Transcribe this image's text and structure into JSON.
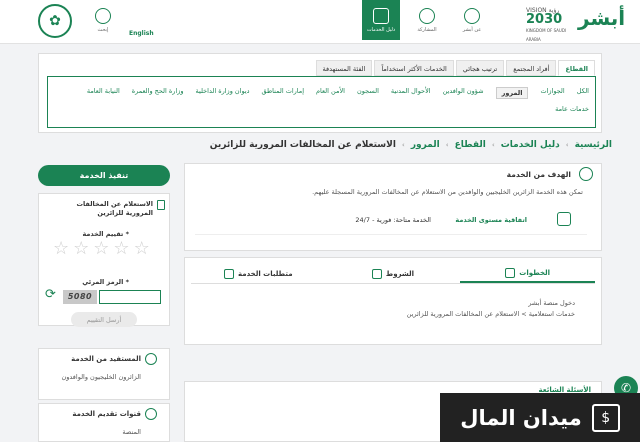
{
  "header": {
    "english_label": "English",
    "nav": [
      {
        "label": "إبحث",
        "icon": "search-icon"
      },
      {
        "label": "دليل الخدمات",
        "icon": "book-icon"
      },
      {
        "label": "المشاركة",
        "icon": "share-icon"
      },
      {
        "label": "عن أبشر",
        "icon": "info-icon"
      }
    ],
    "vision_line1": "VISION رؤية",
    "vision_year": "2030",
    "vision_line2": "KINGDOM OF SAUDI ARABIA",
    "absher_logo": "أبشر"
  },
  "catalog": {
    "tabs": [
      "القطاع",
      "أفراد المجتمع",
      "ترتيب هجائي",
      "الخدمات الأكثر استخداماً",
      "الفئة المستهدفة"
    ],
    "active_tab": "القطاع",
    "chips": [
      "الكل",
      "الجوازات",
      "المرور",
      "شؤون الوافدين",
      "الأحوال المدنية",
      "السجون",
      "الأمن العام",
      "إمارات المناطق",
      "ديوان وزارة الداخلية",
      "وزارة الحج والعمرة",
      "النيابة العامة",
      "خدمات عامة"
    ],
    "active_chip": "المرور"
  },
  "breadcrumb": {
    "items": [
      "الرئيسية",
      "دليل الخدمات",
      "القطاع",
      "المرور"
    ],
    "current": "الاستعلام عن المخالفات المرورية للزائرين"
  },
  "service": {
    "goal_title": "الهدف من الخدمة",
    "goal_desc": "تمكن هذه الخدمة الزائرين الخليجيين والوافدين من الاستعلام عن المخالفات المرورية المسجلة عليهم.",
    "sla_label": "اتفاقية مستوى الخدمة",
    "sla_value": "الخدمة متاحة: فورية - 24/7",
    "tabs": [
      "الخطوات",
      "الشروط",
      "متطلبات الخدمة"
    ],
    "active_tab": "الخطوات",
    "steps": [
      "دخول منصة أبشر",
      "خدمات استعلامية > الاستعلام عن المخالفات المرورية للزائرين"
    ],
    "faq_title": "الأسئلة الشائعة"
  },
  "sidebar": {
    "start_button": "تنفيذ الخدمة",
    "service_title": "الاستعلام عن المخالفات المرورية للزائرين",
    "rating_label": "تقييم الخدمة *",
    "stars": 5,
    "rating_value": 0,
    "captcha_label": "الرمز المرئي *",
    "captcha_image_text": "5080",
    "captcha_value": "",
    "submit_button": "أرسل التقييم",
    "beneficiary_title": "المستفيد من الخدمة",
    "beneficiary_value": "الزائرون الخليجيون والوافدون",
    "channels_title": "قنوات تقديم الخدمة",
    "channels_value": "المنصة"
  },
  "banner": {
    "text": "ميدان المال",
    "logo_glyph": "$"
  },
  "colors": {
    "accent": "#1b8354",
    "star_empty": "#cfcfcf",
    "banner_bg": "#222222"
  }
}
